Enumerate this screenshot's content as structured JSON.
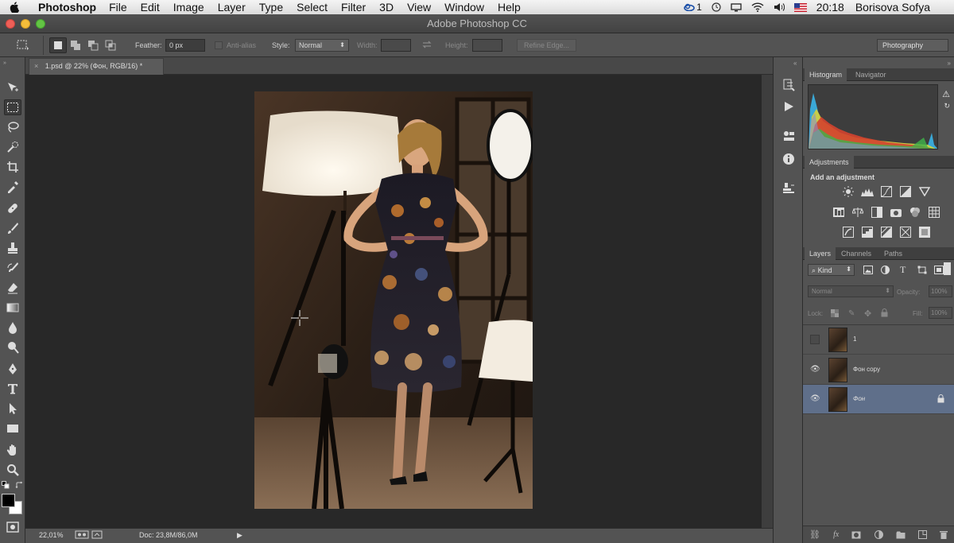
{
  "menubar": {
    "app": "Photoshop",
    "menus": [
      "File",
      "Edit",
      "Image",
      "Layer",
      "Type",
      "Select",
      "Filter",
      "3D",
      "View",
      "Window",
      "Help"
    ],
    "cc_count": "1",
    "clock": "20:18",
    "user": "Borisova Sofya"
  },
  "window": {
    "title": "Adobe Photoshop CC"
  },
  "options": {
    "feather_label": "Feather:",
    "feather_value": "0 px",
    "antialias_label": "Anti-alias",
    "style_label": "Style:",
    "style_value": "Normal",
    "width_label": "Width:",
    "height_label": "Height:",
    "refine_edge": "Refine Edge...",
    "workspace": "Photography"
  },
  "document": {
    "tab_title": "1.psd @ 22% (Фон, RGB/16) *",
    "zoom": "22,01%",
    "doc_size": "Doc: 23,8M/86,0M"
  },
  "panels": {
    "histogram_tab": "Histogram",
    "navigator_tab": "Navigator",
    "adjustments_tab": "Adjustments",
    "add_adjustment": "Add an adjustment",
    "layers_tab": "Layers",
    "channels_tab": "Channels",
    "paths_tab": "Paths",
    "kind_filter": "Kind",
    "blend_mode": "Normal",
    "opacity_label": "Opacity:",
    "opacity_value": "100%",
    "lock_label": "Lock:",
    "fill_label": "Fill:",
    "fill_value": "100%"
  },
  "layers": [
    {
      "name": "1",
      "visible": false,
      "selected": false
    },
    {
      "name": "Фон copy",
      "visible": true,
      "selected": false
    },
    {
      "name": "Фон",
      "visible": true,
      "selected": true,
      "locked": true
    }
  ],
  "colors": {
    "accent_selected_layer": "#5f6f8a",
    "panel_bg": "#535353",
    "canvas_bg": "#282828"
  }
}
